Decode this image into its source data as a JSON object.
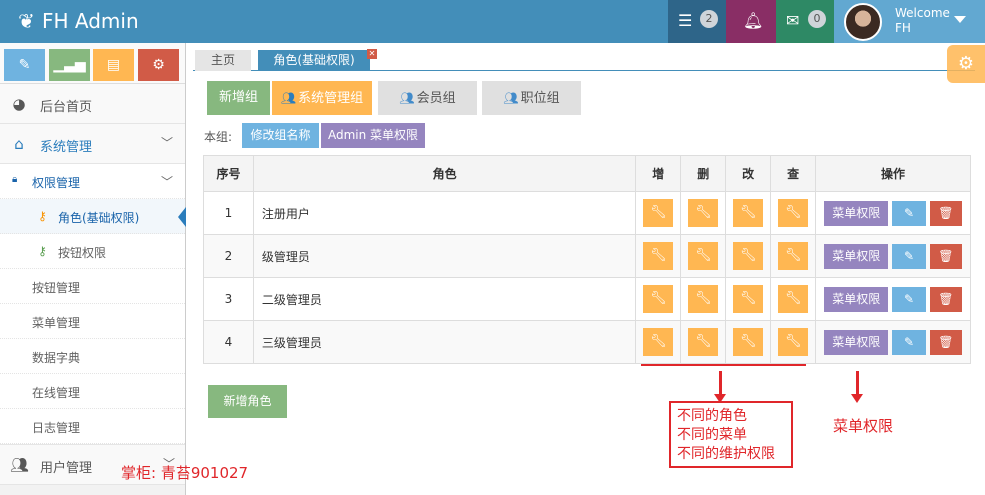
{
  "navbar": {
    "brand": "FH Admin",
    "tasks_badge": "2",
    "mail_badge": "0",
    "welcome": "Welcome",
    "username": "FH"
  },
  "sidebar": {
    "items": [
      {
        "label": "后台首页",
        "icon": "dashboard-icon"
      },
      {
        "label": "系统管理",
        "icon": "desktop-icon"
      }
    ],
    "submenu": [
      {
        "label": "权限管理"
      },
      {
        "label": "角色(基础权限)"
      },
      {
        "label": "按钮权限"
      },
      {
        "label": "按钮管理"
      },
      {
        "label": "菜单管理"
      },
      {
        "label": "数据字典"
      },
      {
        "label": "在线管理"
      },
      {
        "label": "日志管理"
      }
    ],
    "bottom": {
      "label": "用户管理"
    }
  },
  "tabs": {
    "home": "主页",
    "role": "角色(基础权限)"
  },
  "groups": {
    "add": "新增组",
    "sys": "系统管理组",
    "member": "会员组",
    "position": "职位组"
  },
  "group_row": {
    "label": "本组:",
    "rename": "修改组名称",
    "admin_menu": "Admin 菜单权限"
  },
  "table": {
    "headers": [
      "序号",
      "角色",
      "增",
      "删",
      "改",
      "查",
      "操作"
    ],
    "rows": [
      {
        "no": "1",
        "name": "注册用户"
      },
      {
        "no": "2",
        "name": "级管理员"
      },
      {
        "no": "3",
        "name": "二级管理员"
      },
      {
        "no": "4",
        "name": "三级管理员"
      }
    ],
    "menu_perm": "菜单权限"
  },
  "add_role": "新增角色",
  "annotations": {
    "box_lines": [
      "不同的角色",
      "不同的菜单",
      "不同的维护权限"
    ],
    "menu_perm": "菜单权限"
  },
  "watermark": "掌柜: 青苔901027",
  "colors": {
    "navbar": "#438eb9",
    "accent_red": "#e0262a"
  }
}
